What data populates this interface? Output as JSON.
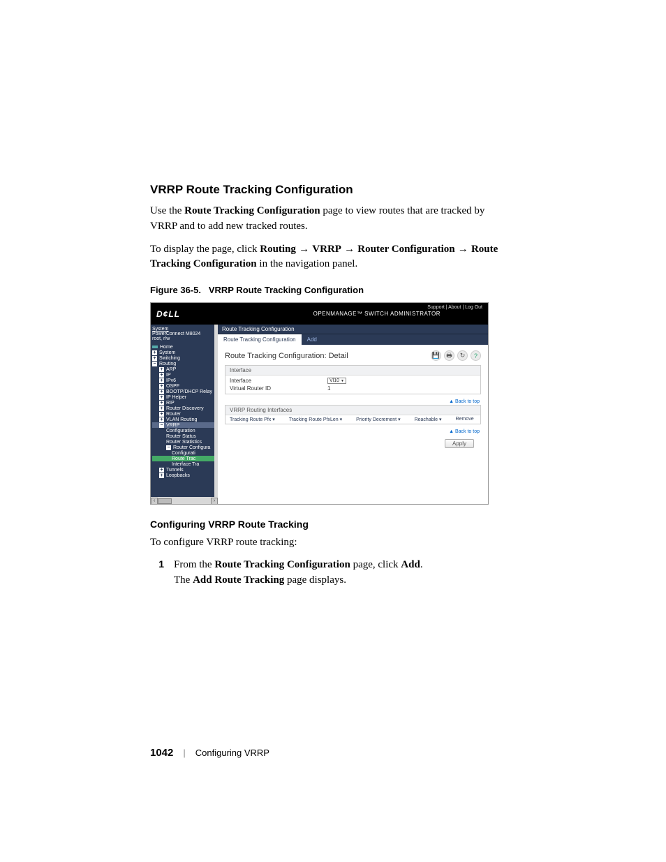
{
  "heading": "VRRP Route Tracking Configuration",
  "para1_a": "Use the ",
  "para1_b": "Route Tracking Configuration ",
  "para1_c": "page to view routes that are tracked by VRRP and to add new tracked routes.",
  "para2_a": "To display the page, click ",
  "para2_b": "Routing",
  "para2_c": "VRRP",
  "para2_d": "Router Configuration",
  "para2_e": "Route Tracking Configuration",
  "para2_f": " in the navigation panel.",
  "fig_caption_a": "Figure 36-5.",
  "fig_caption_b": "VRRP Route Tracking Configuration",
  "screenshot": {
    "logo": "D¢LL",
    "brand": "OPENMANAGE™ SWITCH ADMINISTRATOR",
    "top_links": "Support | About | Log Out",
    "side": {
      "system": "System",
      "model": "PowerConnect M8024",
      "user": "root, r/w",
      "items": [
        "Home",
        "System",
        "Switching",
        "Routing",
        "ARP",
        "IP",
        "IPv6",
        "OSPF",
        "BOOTP/DHCP Relay",
        "IP Helper",
        "RIP",
        "Router Discovery",
        "Router",
        "VLAN Routing",
        "VRRP",
        "Configuration",
        "Router Status",
        "Router Statistics",
        "Router Configura",
        "Configurati",
        "Route Trac",
        "Interface Tra",
        "Tunnels",
        "Loopbacks"
      ]
    },
    "breadcrumb": "Route Tracking Configuration",
    "tabs": {
      "active": "Route Tracking Configuration",
      "inactive": "Add"
    },
    "title": "Route Tracking Configuration: Detail",
    "icons": [
      "save-icon",
      "print-icon",
      "refresh-icon",
      "help-icon"
    ],
    "group1": {
      "header": "Interface",
      "interface_label": "Interface",
      "interface_value": "Vl10",
      "vrid_label": "Virtual Router ID",
      "vrid_value": "1"
    },
    "group2_header": "VRRP Routing Interfaces",
    "cols": [
      "Tracking Route Pfx",
      "Tracking Route PfxLen",
      "Priority Decrement",
      "Reachable",
      "Remove"
    ],
    "back_to_top": "▲ Back to top",
    "apply": "Apply"
  },
  "sub_heading": "Configuring VRRP Route Tracking",
  "sub_intro": "To configure VRRP route tracking:",
  "step1_num": "1",
  "step1_a": "From the ",
  "step1_b": "Route Tracking Configuration",
  "step1_c": " page, click ",
  "step1_d": "Add",
  "step1_e": ".",
  "step1_line2_a": "The ",
  "step1_line2_b": "Add Route Tracking",
  "step1_line2_c": " page displays.",
  "footer_page": "1042",
  "footer_sep": "|",
  "footer_text": "Configuring VRRP"
}
